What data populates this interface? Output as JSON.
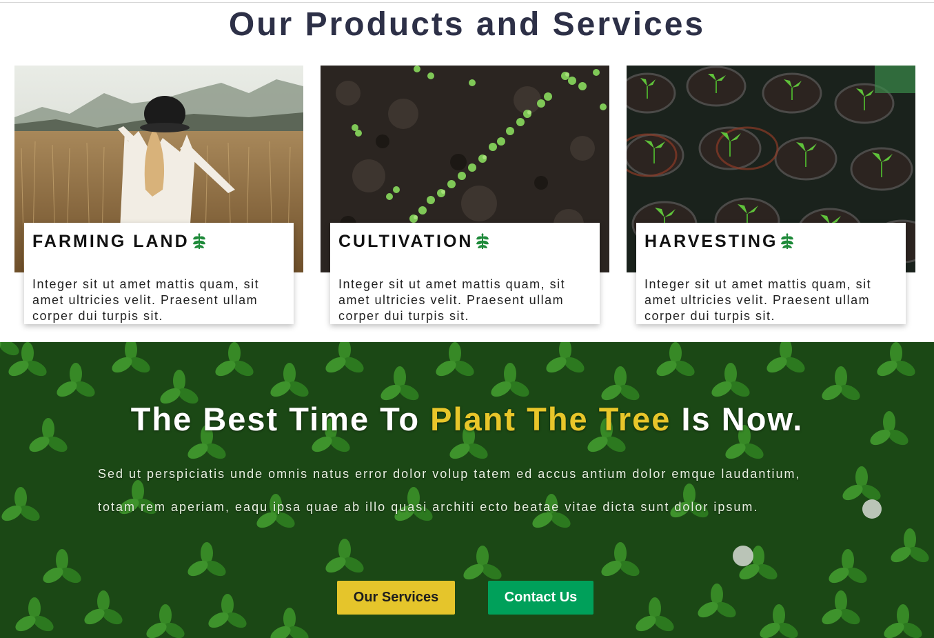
{
  "section": {
    "title": "Our Products and Services"
  },
  "cards": [
    {
      "title": "FARMING LAND",
      "icon": "leaf-icon",
      "text": "Integer sit ut amet mattis quam, sit amet ultricies velit. Praesent ullam corper dui turpis sit.",
      "image": "woman-in-wheat-field-photo"
    },
    {
      "title": "CULTIVATION",
      "icon": "leaf-icon",
      "text": "Integer sit ut amet mattis quam, sit amet ultricies velit. Praesent ullam corper dui turpis sit.",
      "image": "seedlings-in-soil-photo"
    },
    {
      "title": "HARVESTING",
      "icon": "leaf-icon",
      "text": "Integer sit ut amet mattis quam, sit amet ultricies velit. Praesent ullam corper dui turpis sit.",
      "image": "seedlings-in-pots-photo"
    }
  ],
  "hero": {
    "heading_start": "The Best Time To ",
    "heading_accent": "Plant The Tree",
    "heading_end": " Is Now.",
    "paragraph": "Sed ut perspiciatis unde omnis natus error dolor volup tatem ed accus antium dolor emque laudantium, totam rem aperiam, eaqu ipsa quae ab illo quasi architi ecto beatae vitae dicta sunt dolor ipsum.",
    "background": "green-clover-leaves-photo",
    "buttons": {
      "services": "Our Services",
      "contact": "Contact Us"
    }
  },
  "colors": {
    "title": "#2d3047",
    "accent_yellow": "#e8c62a",
    "accent_green": "#00a05a",
    "leaf_icon": "#1f8a3a"
  }
}
